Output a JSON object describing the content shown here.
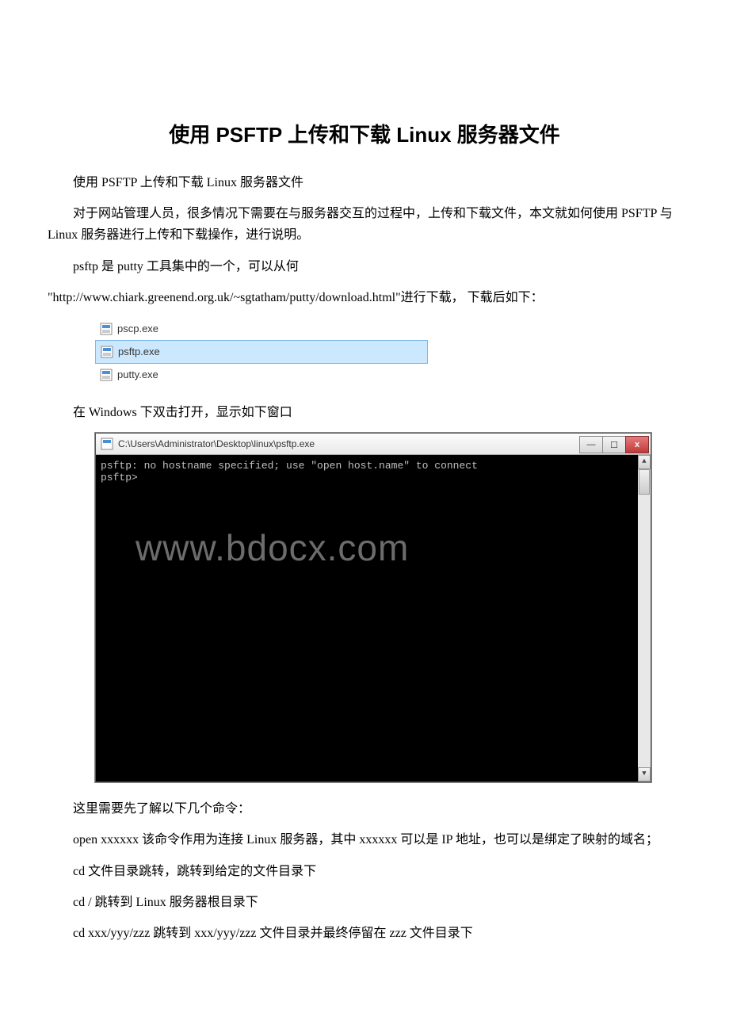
{
  "title": "使用 PSFTP 上传和下载 Linux 服务器文件",
  "p1": "使用 PSFTP 上传和下载 Linux 服务器文件",
  "p2": "对于网站管理人员，很多情况下需要在与服务器交互的过程中，上传和下载文件，本文就如何使用 PSFTP 与 Linux 服务器进行上传和下载操作，进行说明。",
  "p3a": "psftp 是 putty 工具集中的一个，可以从何",
  "p3b": "\"http://www.chiark.greenend.org.uk/~sgtatham/putty/download.html\"进行下载， 下载后如下：",
  "files": {
    "f1": "pscp.exe",
    "f2": "psftp.exe",
    "f3": "putty.exe"
  },
  "p4": "在 Windows 下双击打开，显示如下窗口",
  "console": {
    "title": "C:\\Users\\Administrator\\Desktop\\linux\\psftp.exe",
    "line1": "psftp: no hostname specified; use \"open host.name\" to connect",
    "line2": "psftp>",
    "watermark": "www.bdocx.com",
    "min": "—",
    "max": "☐",
    "close": "x"
  },
  "p5": "这里需要先了解以下几个命令：",
  "p6": "open xxxxxx   该命令作用为连接 Linux 服务器，其中 xxxxxx 可以是 IP 地址，也可以是绑定了映射的域名；",
  "p7": "cd  文件目录跳转，跳转到给定的文件目录下",
  "p8": "cd  /  跳转到 Linux 服务器根目录下",
  "p9": "cd  xxx/yyy/zzz 跳转到 xxx/yyy/zzz 文件目录并最终停留在 zzz 文件目录下"
}
